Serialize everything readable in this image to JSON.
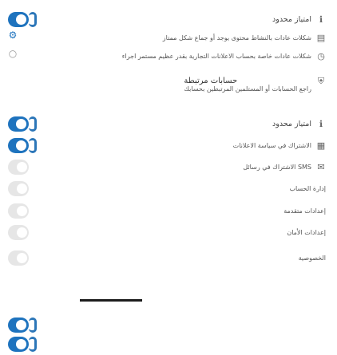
{
  "colors": {
    "accent": "#1e73be",
    "text": "#444444",
    "toggle_off": "#e8e8e8"
  },
  "rows": {
    "r1": "امتياز محدود",
    "r2": "شكلات عادات بالنشاط محتوى يوجد أو جماع شكل ممتاز",
    "r3": "شكلات عادات خاصة بحساب الاعلانات التجارية بقدر عظيم مستمر اجراء",
    "r4_title": "حسابات مرتبطة",
    "r4_sub": "راجع الحسابات أو المستلمين المرتبطين بحسابك",
    "r5": "امتياز محدود",
    "r6": "الاشتراك في سياسة الاعلانات",
    "r7": "SMS الاشتراك في رسائل",
    "r8": "إدارة الحساب",
    "r9": "إعدادات متقدمة",
    "r10": "إعدادات الأمان",
    "r11": "الخصوصية"
  },
  "toggles": {
    "t1": "on",
    "t2": "on",
    "t3": "on",
    "t4": "on",
    "t5": "on",
    "t6": "on",
    "t7": "on",
    "t8": "on",
    "t9": "on"
  }
}
